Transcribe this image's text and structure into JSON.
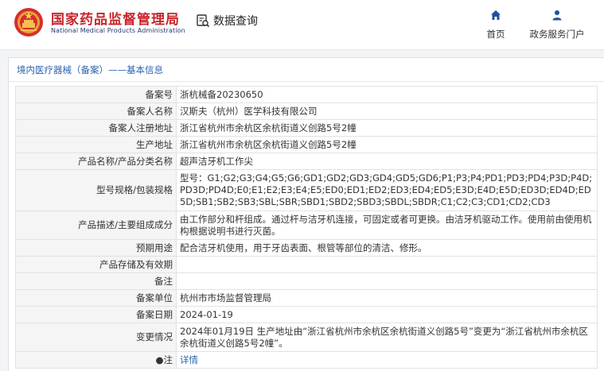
{
  "header": {
    "title_cn": "国家药品监督管理局",
    "title_en": "National Medical Products Administration",
    "search_label": "数据查询",
    "nav": [
      {
        "label": "首页",
        "icon": "home-icon"
      },
      {
        "label": "政务服务门户",
        "icon": "user-icon"
      }
    ]
  },
  "breadcrumb": "境内医疗器械（备案）——基本信息",
  "rows": [
    {
      "key": "备案号",
      "value": "浙杭械备20230650"
    },
    {
      "key": "备案人名称",
      "value": "汉斯夫（杭州）医学科技有限公司"
    },
    {
      "key": "备案人注册地址",
      "value": "浙江省杭州市余杭区余杭街道义创路5号2幢"
    },
    {
      "key": "生产地址",
      "value": "浙江省杭州市余杭区余杭街道义创路5号2幢"
    },
    {
      "key": "产品名称/产品分类名称",
      "value": "超声洁牙机工作尖"
    },
    {
      "key": "型号规格/包装规格",
      "value": "型号：G1;G2;G3;G4;G5;G6;GD1;GD2;GD3;GD4;GD5;GD6;P1;P3;P4;PD1;PD3;PD4;P3D;P4D;PD3D;PD4D;E0;E1;E2;E3;E4;E5;ED0;ED1;ED2;ED3;ED4;ED5;E3D;E4D;E5D;ED3D;ED4D;ED5D;SB1;SB2;SB3;SBL;SBR;SBD1;SBD2;SBD3;SBDL;SBDR;C1;C2;C3;CD1;CD2;CD3"
    },
    {
      "key": "产品描述/主要组成成分",
      "value": "由工作部分和杆组成。通过杆与洁牙机连接，可固定或者可更换。由洁牙机驱动工作。使用前由使用机构根据说明书进行灭菌。"
    },
    {
      "key": "预期用途",
      "value": "配合洁牙机使用，用于牙齿表面、根管等部位的清洁、修形。"
    },
    {
      "key": "产品存储及有效期",
      "value": ""
    },
    {
      "key": "备注",
      "value": ""
    },
    {
      "key": "备案单位",
      "value": "杭州市市场监督管理局"
    },
    {
      "key": "备案日期",
      "value": "2024-01-19"
    },
    {
      "key": "变更情况",
      "value": "2024年01月19日 生产地址由“浙江省杭州市余杭区余杭街道义创路5号”变更为“浙江省杭州市余杭区余杭街道义创路5号2幢”。"
    }
  ],
  "note_row": {
    "key": "注",
    "icon": "pin-icon",
    "link": "详情"
  },
  "colors": {
    "brand_red": "#c8252b",
    "link_blue": "#2c62b0",
    "key_bg": "#f5f5f6"
  }
}
